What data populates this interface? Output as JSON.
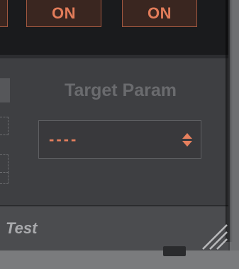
{
  "toggles": [
    {
      "label": "ON"
    },
    {
      "label": "ON"
    }
  ],
  "target_param": {
    "label": "Target Param",
    "selected_value": "----"
  },
  "footer": {
    "title": "Test"
  },
  "colors": {
    "accent": "#e6805e",
    "toggle_border": "#a0573f",
    "panel_bg": "#3e3f42",
    "header_bg": "#1a1b1d",
    "label_gray": "#6a6b6e"
  },
  "icons": [
    "chevron-updown-icon",
    "resize-grip-icon"
  ]
}
